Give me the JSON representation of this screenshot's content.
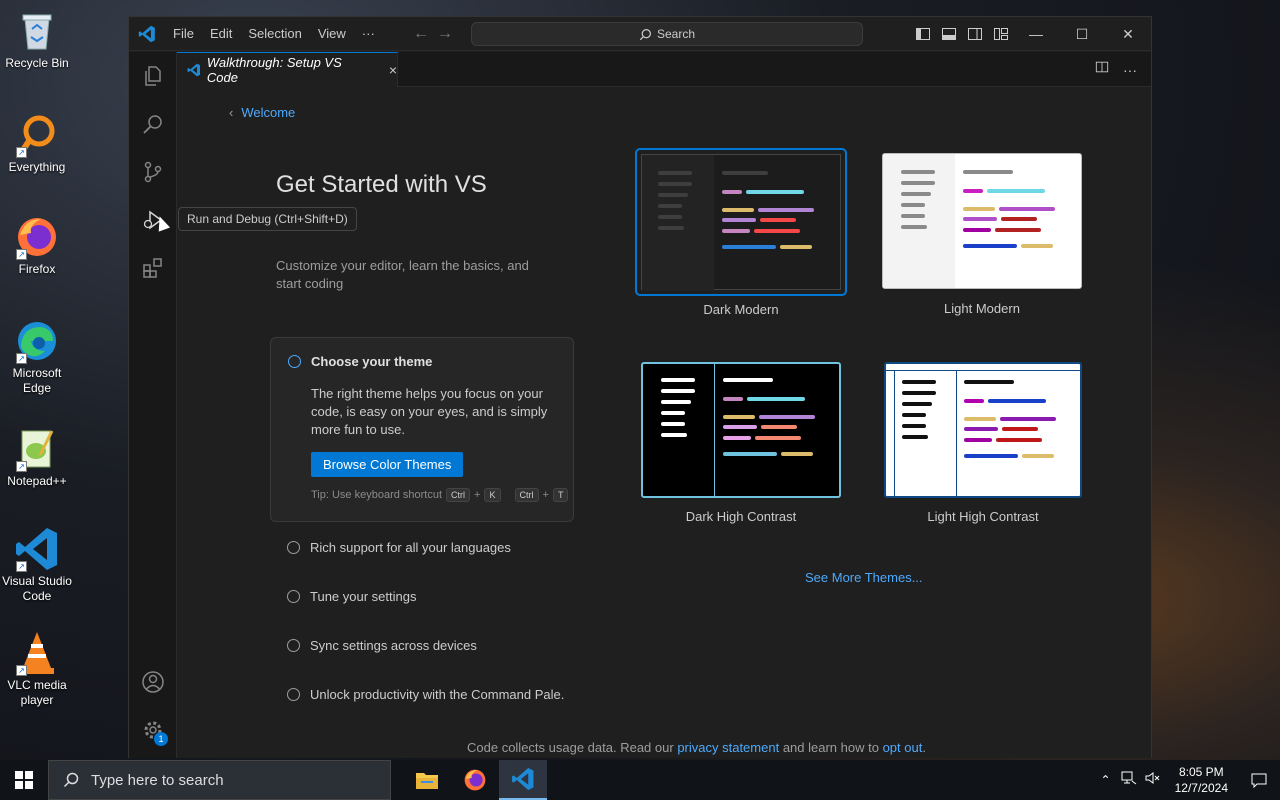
{
  "desktop": {
    "icons": [
      {
        "label": "Recycle Bin"
      },
      {
        "label": "Everything"
      },
      {
        "label": "Firefox"
      },
      {
        "label": "Microsoft Edge"
      },
      {
        "label": "Notepad++"
      },
      {
        "label": "Visual Studio Code"
      },
      {
        "label": "VLC media player"
      }
    ]
  },
  "titlebar": {
    "menu": [
      "File",
      "Edit",
      "Selection",
      "View",
      "···"
    ],
    "search_label": "Search"
  },
  "tooltip": "Run and Debug (Ctrl+Shift+D)",
  "tab": {
    "title": "Walkthrough: Setup VS Code",
    "close": "×"
  },
  "walkthrough": {
    "back_label": "Welcome",
    "title": "Get Started with VS",
    "subtitle": "Customize your editor, learn the basics, and start coding",
    "active_step": {
      "title": "Choose your theme",
      "description": "The right theme helps you focus on your code, is easy on your eyes, and is simply more fun to use.",
      "button": "Browse Color Themes",
      "tip": "Tip: Use keyboard shortcut",
      "shortcut": [
        "Ctrl",
        "+",
        "K",
        "Ctrl",
        "+",
        "T"
      ]
    },
    "steps": [
      "Rich support for all your languages",
      "Tune your settings",
      "Sync settings across devices",
      "Unlock productivity with the Command Pale."
    ],
    "themes": [
      {
        "name": "Dark Modern",
        "selected": true
      },
      {
        "name": "Light Modern",
        "selected": false
      },
      {
        "name": "Dark High Contrast",
        "selected": false
      },
      {
        "name": "Light High Contrast",
        "selected": false
      }
    ],
    "see_more": "See More Themes...",
    "footer": {
      "prefix": "Code collects usage data. Read our",
      "privacy_link": "privacy statement",
      "middle": "and learn how to",
      "opt_out_link": "opt out",
      "suffix": "."
    }
  },
  "activitybar": {
    "accounts_badge": "1"
  },
  "taskbar": {
    "search_placeholder": "Type here to search",
    "time": "8:05 PM",
    "date": "12/7/2024"
  },
  "colors": {
    "accent": "#0078d4",
    "link": "#4daafc",
    "selected_border": "#0078d4"
  }
}
